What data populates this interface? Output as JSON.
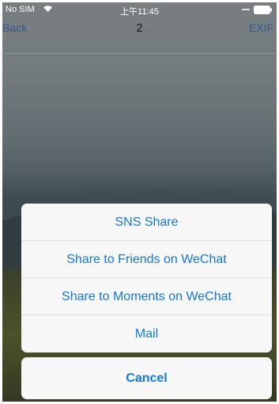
{
  "status_bar": {
    "carrier": "No SIM",
    "time": "上午11:45",
    "icons": [
      "wifi-icon",
      "signal-icon",
      "battery-icon"
    ]
  },
  "nav_bar": {
    "back_label": "Back",
    "title": "2",
    "right_label": "EXIF"
  },
  "action_sheet": {
    "options": [
      "SNS Share",
      "Share to Friends on WeChat",
      "Share to Moments on WeChat",
      "Mail"
    ],
    "cancel_label": "Cancel"
  },
  "colors": {
    "accent": "#1477d6",
    "sheet_background": "#f7f7f7"
  }
}
